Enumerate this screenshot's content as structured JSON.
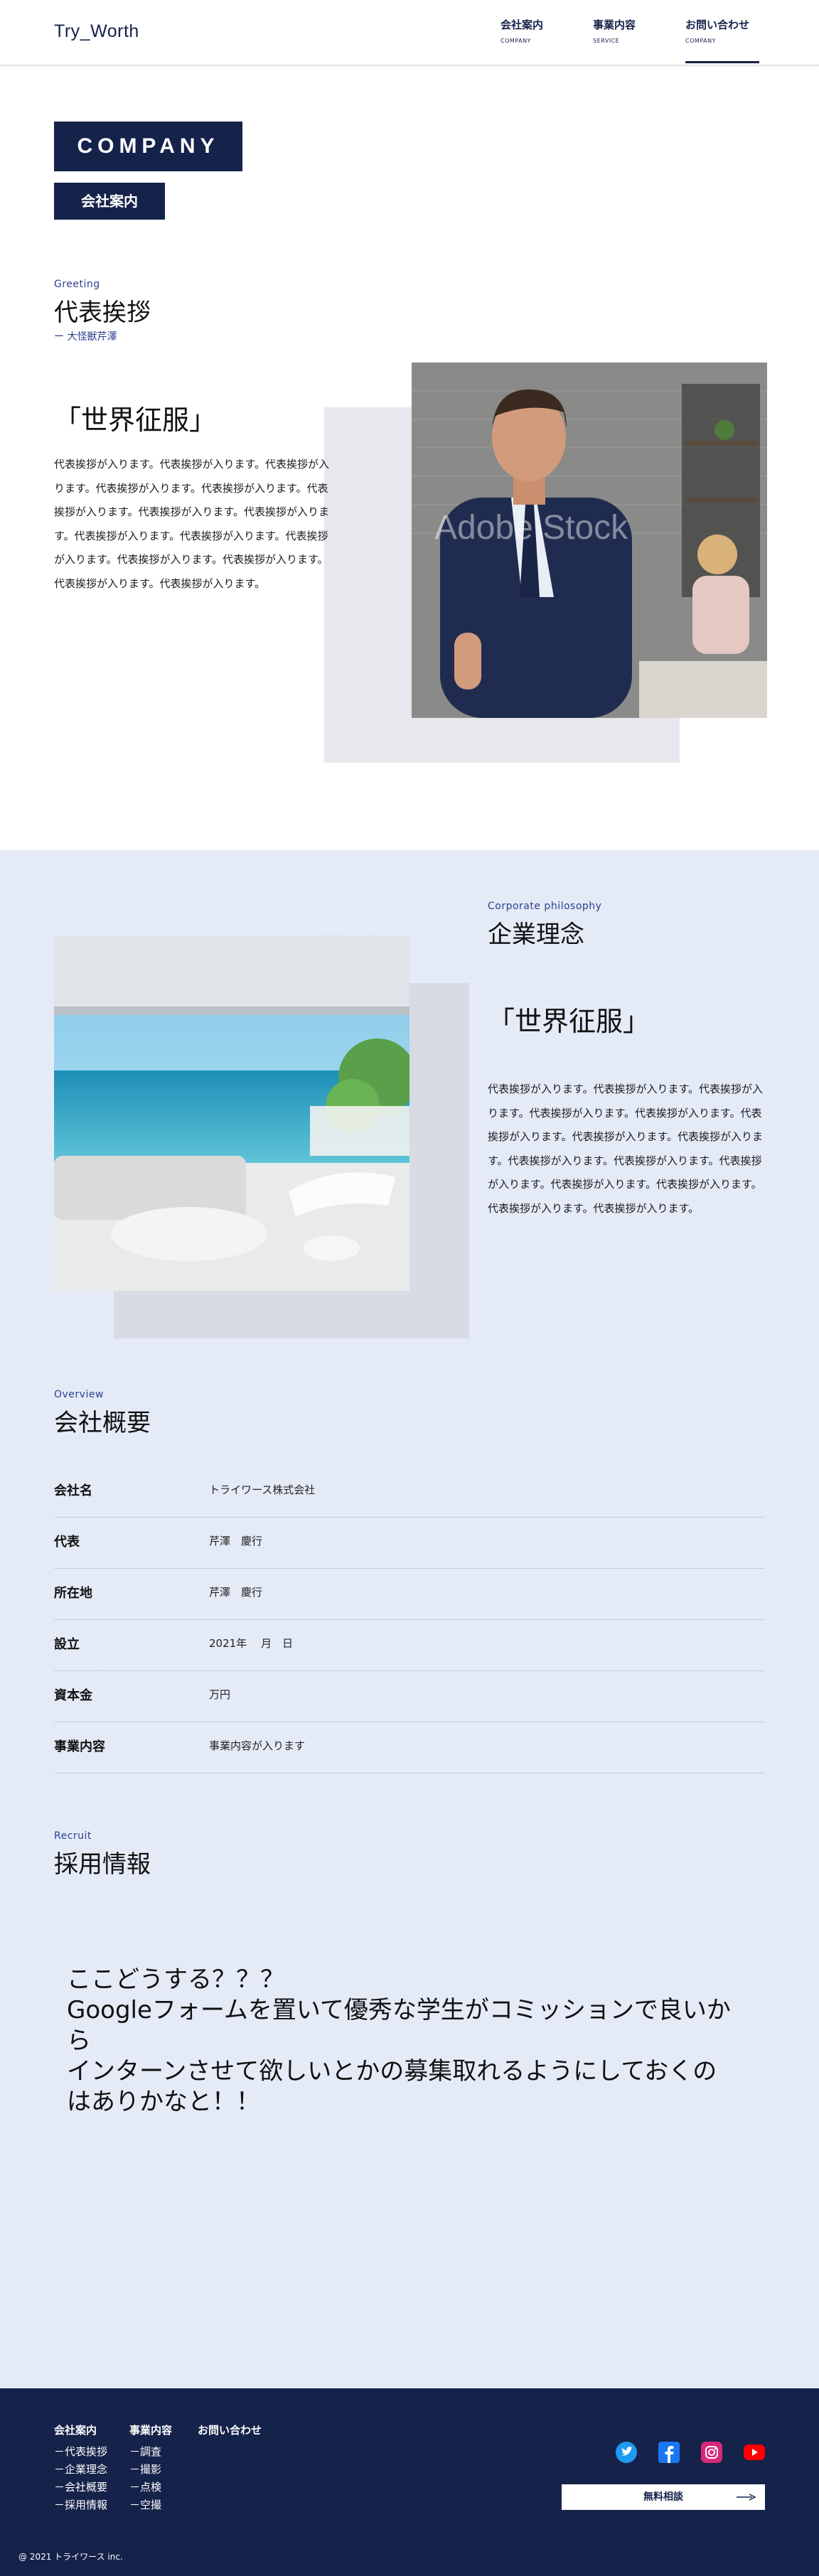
{
  "header": {
    "logo": "Try_Worth",
    "nav": [
      {
        "jp": "会社案内",
        "en": "COMPANY"
      },
      {
        "jp": "事業内容",
        "en": "SERVICE"
      },
      {
        "jp": "お問い合わせ",
        "en": "COMPANY"
      }
    ]
  },
  "hero": {
    "title": "COMPANY",
    "subtitle": "会社案内"
  },
  "greeting": {
    "en": "Greeting",
    "jp": "代表挨拶",
    "sub": "ー 大怪獣芹澤",
    "catch": "「世界征服」",
    "lines": [
      "代表挨拶が入ります。代表挨拶が入ります。代表挨拶が入",
      "ります。代表挨拶が入ります。代表挨拶が入ります。代表",
      "挨拶が入ります。代表挨拶が入ります。代表挨拶が入りま",
      "す。代表挨拶が入ります。代表挨拶が入ります。代表挨拶",
      "が入ります。代表挨拶が入ります。代表挨拶が入ります。",
      "代表挨拶が入ります。代表挨拶が入ります。"
    ],
    "watermark": "Adobe Stock"
  },
  "philosophy": {
    "en": "Corporate philosophy",
    "jp": "企業理念",
    "catch": "「世界征服」",
    "lines": [
      "代表挨拶が入ります。代表挨拶が入ります。代表挨拶が入",
      "ります。代表挨拶が入ります。代表挨拶が入ります。代表",
      "挨拶が入ります。代表挨拶が入ります。代表挨拶が入りま",
      "す。代表挨拶が入ります。代表挨拶が入ります。代表挨拶",
      "が入ります。代表挨拶が入ります。代表挨拶が入ります。",
      "代表挨拶が入ります。代表挨拶が入ります。"
    ]
  },
  "overview": {
    "en": "Overview",
    "jp": "会社概要",
    "rows": [
      {
        "k": "会社名",
        "v": "トライワース株式会社"
      },
      {
        "k": "代表",
        "v": "芹澤　慶行"
      },
      {
        "k": "所在地",
        "v": "芹澤　慶行"
      },
      {
        "k": "設立",
        "v": "2021年　 月　日"
      },
      {
        "k": "資本金",
        "v": "万円"
      },
      {
        "k": "事業内容",
        "v": "事業内容が入ります"
      }
    ]
  },
  "recruit": {
    "en": "Recruit",
    "jp": "採用情報",
    "message": "ここどうする？？？\nGoogleフォームを置いて優秀な学生がコミッションで良いから\nインターンさせて欲しいとかの募集取れるようにしておくのはありかなと！！"
  },
  "footer": {
    "cols": [
      {
        "h": "会社案内",
        "items": [
          "－代表挨拶",
          "－企業理念",
          "－会社概要",
          "－採用情報"
        ]
      },
      {
        "h": "事業内容",
        "items": [
          "－調査",
          "－撮影",
          "－点検",
          "－空撮"
        ]
      },
      {
        "h": "お問い合わせ",
        "items": []
      }
    ],
    "consult": "無料相談",
    "copyright": "@ 2021 トライワース inc.",
    "social": [
      {
        "name": "twitter-icon",
        "color": "#1d9bf0"
      },
      {
        "name": "facebook-icon",
        "color": "#1877f2"
      },
      {
        "name": "instagram-icon",
        "color": "#d6297a"
      },
      {
        "name": "youtube-icon",
        "color": "#ff0000"
      }
    ]
  },
  "colors": {
    "navy": "#15224a",
    "accent": "#2c3e8f",
    "bg_blue": "#e4ebf6"
  }
}
